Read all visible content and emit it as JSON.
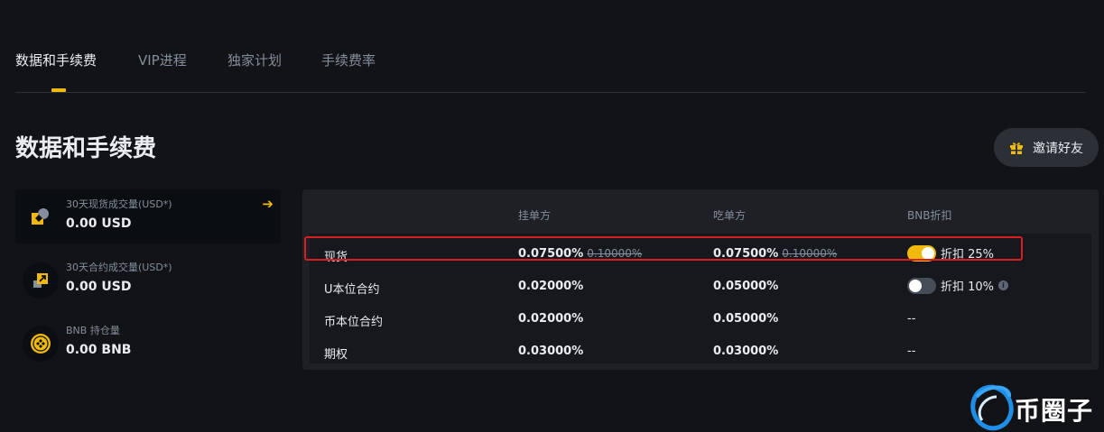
{
  "tabs": [
    {
      "label": "数据和手续费",
      "active": true
    },
    {
      "label": "VIP进程",
      "active": false
    },
    {
      "label": "独家计划",
      "active": false
    },
    {
      "label": "手续费率",
      "active": false
    }
  ],
  "page_title": "数据和手续费",
  "invite_button": {
    "label": "邀请好友",
    "icon": "gift-icon"
  },
  "stats": [
    {
      "label": "30天现货成交量(USD*)",
      "value": "0.00 USD",
      "icon": "spot-volume-icon"
    },
    {
      "label": "30天合约成交量(USD*)",
      "value": "0.00 USD",
      "icon": "futures-volume-icon"
    },
    {
      "label": "BNB 持仓量",
      "value": "0.00 BNB",
      "icon": "bnb-coin-icon"
    }
  ],
  "fee_table": {
    "headers": {
      "maker": "挂单方",
      "taker": "吃单方",
      "bnb": "BNB折扣"
    },
    "rows": [
      {
        "name": "现货",
        "maker": "0.07500%",
        "maker_orig": "0.10000%",
        "taker": "0.07500%",
        "taker_orig": "0.10000%",
        "bnb_toggle": "on",
        "bnb_text": "折扣 25%"
      },
      {
        "name": "U本位合约",
        "maker": "0.02000%",
        "taker": "0.05000%",
        "bnb_toggle": "off",
        "bnb_text": "折扣 10%"
      },
      {
        "name": "币本位合约",
        "maker": "0.02000%",
        "taker": "0.05000%",
        "bnb_text": "--"
      },
      {
        "name": "期权",
        "maker": "0.03000%",
        "taker": "0.03000%",
        "bnb_text": "--"
      }
    ]
  },
  "watermark": {
    "text": "币圈子"
  },
  "colors": {
    "accent": "#f0b90b",
    "background": "#121317",
    "panel": "#1e2026",
    "highlight": "#d61f1f"
  }
}
